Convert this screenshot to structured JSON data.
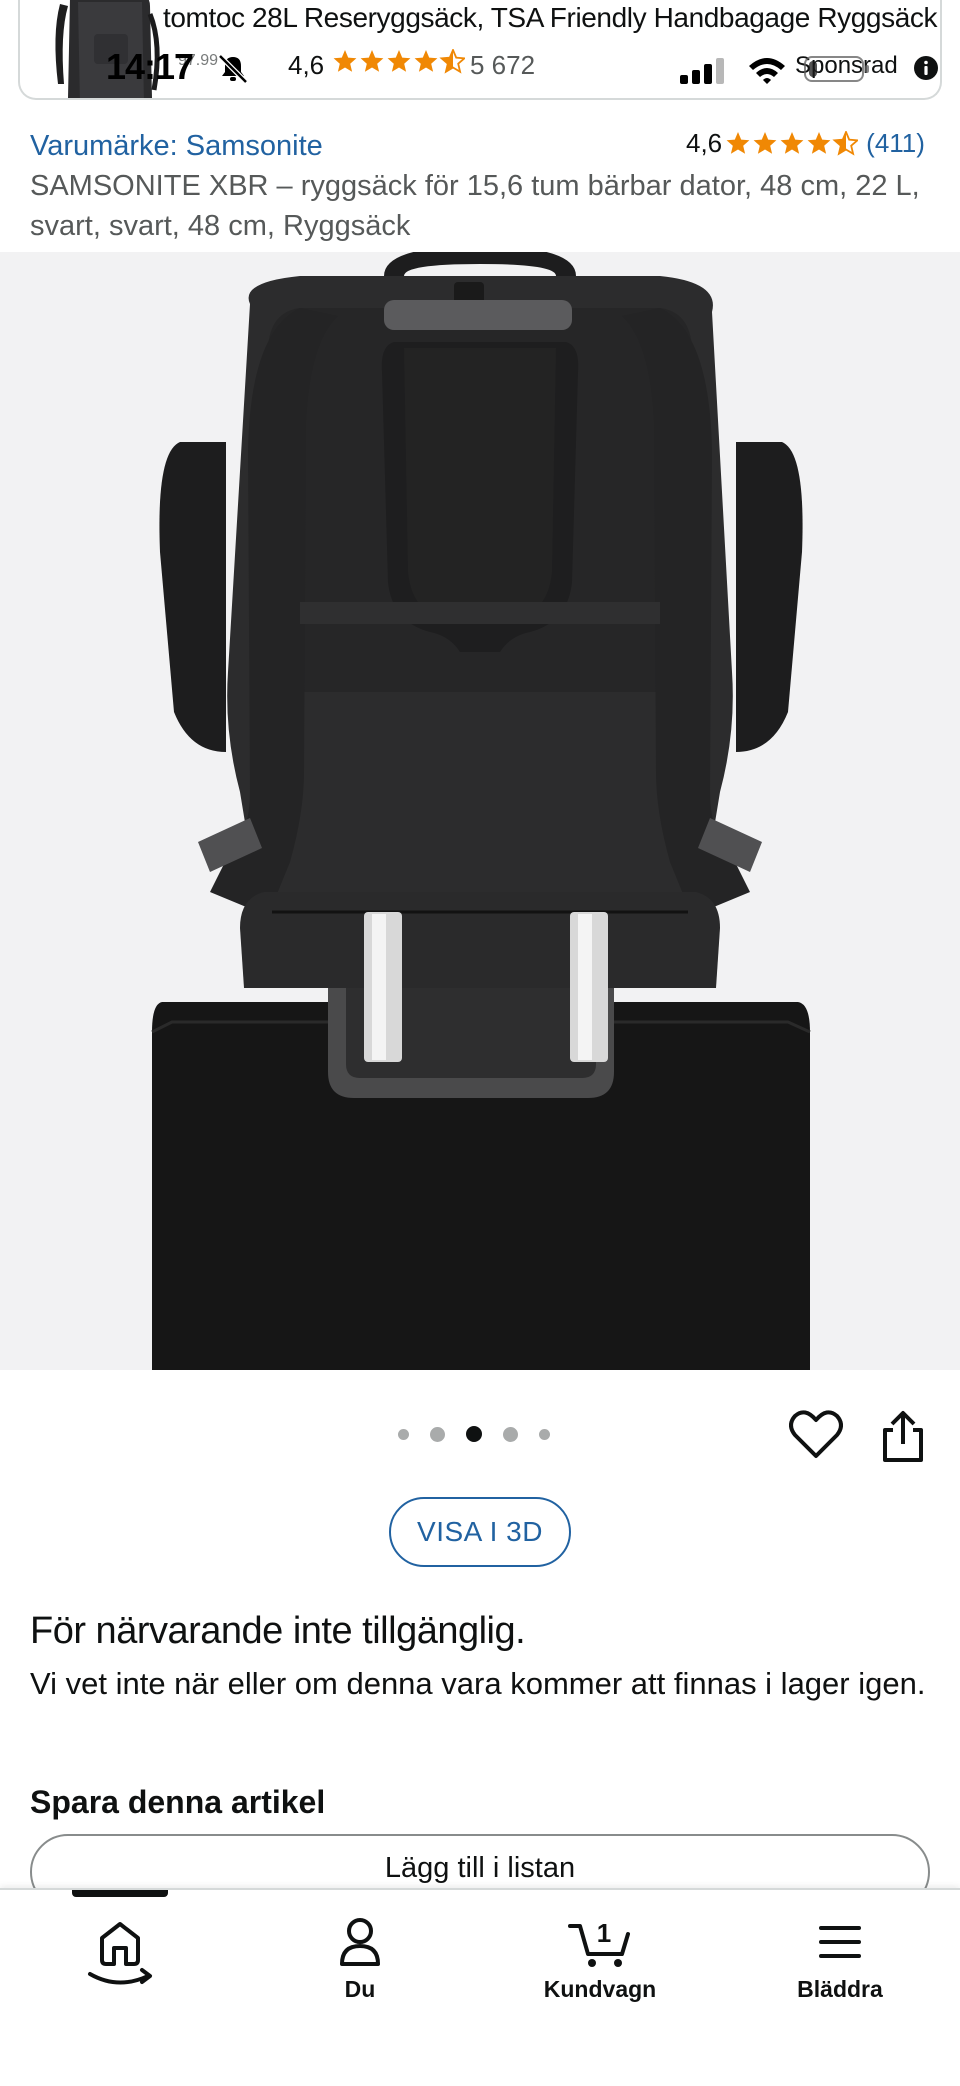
{
  "sponsored_ad": {
    "title": "tomtoc 28L Reseryggsäck, TSA Friendly Handbagage Ryggsäck",
    "price_fragment": "97.99",
    "rating": "4,6",
    "rating_value": 4.6,
    "review_count": "5 672",
    "label": "Sponsrad"
  },
  "status_bar": {
    "time": "14:17",
    "battery_level": 0.15
  },
  "product": {
    "brand_link": "Varumärke: Samsonite",
    "rating": "4,6",
    "rating_value": 4.6,
    "review_count": "(411)",
    "title": "SAMSONITE XBR – ryggsäck för 15,6 tum bärbar dator, 48 cm, 22 L, svart, svart, 48 cm, Ryggsäck"
  },
  "carousel": {
    "total": 5,
    "active_index": 2
  },
  "actions": {
    "view_3d": "VISA I 3D"
  },
  "availability": {
    "title": "För närvarande inte tillgänglig.",
    "text": "Vi vet inte när eller om denna vara kommer att finnas i lager igen."
  },
  "save": {
    "heading": "Spara denna artikel",
    "add_to_list": "Lägg till i listan"
  },
  "bottom_nav": {
    "home": "",
    "you": "Du",
    "cart": "Kundvagn",
    "cart_count": "1",
    "menu": "Bläddra"
  },
  "colors": {
    "link_blue": "#2162a1",
    "star_orange": "#f08804",
    "text_dark": "#0f1111",
    "text_gray": "#565959"
  }
}
